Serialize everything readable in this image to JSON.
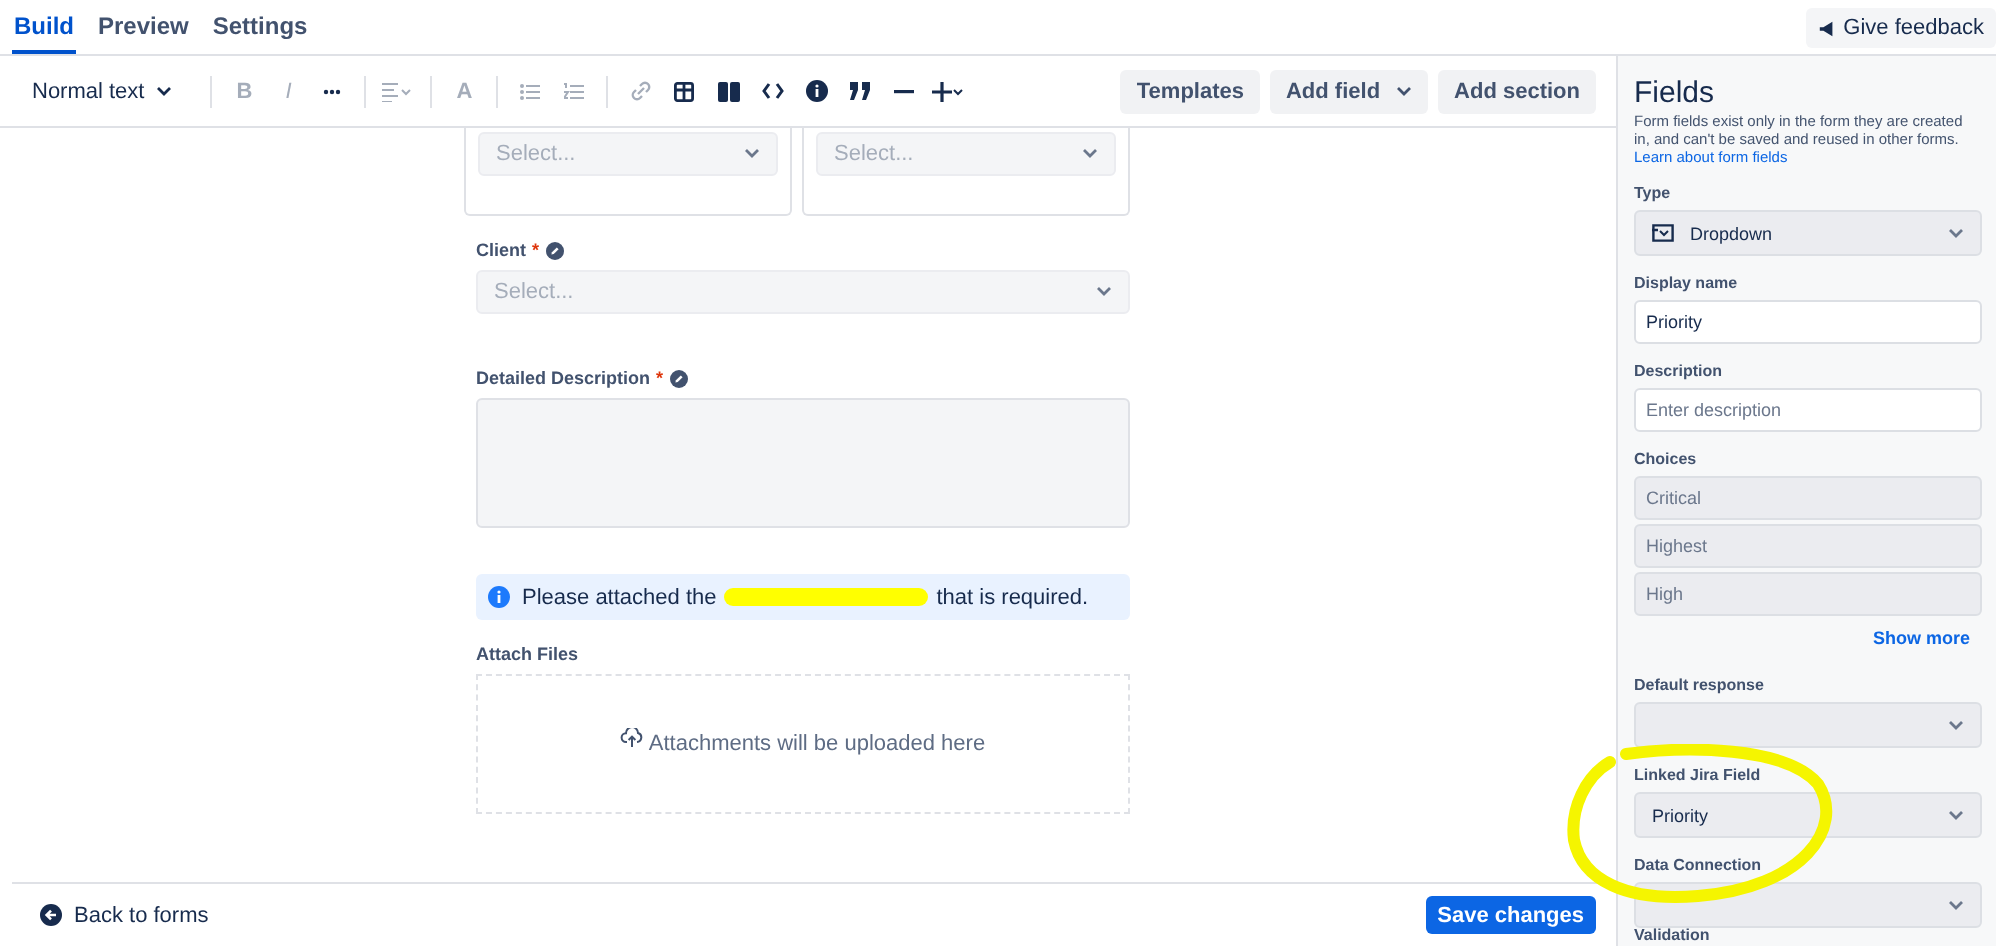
{
  "tabs": [
    {
      "label": "Build",
      "selected": true
    },
    {
      "label": "Preview",
      "selected": false
    },
    {
      "label": "Settings",
      "selected": false
    }
  ],
  "feedback_button": "Give feedback",
  "toolbar": {
    "text_style": "Normal text",
    "tools": [
      {
        "kind": "glyph",
        "glyph": "B",
        "disabled": true
      },
      {
        "kind": "glyph",
        "glyph": "I",
        "disabled": true
      },
      {
        "kind": "more",
        "disabled": false
      },
      {
        "kind": "align",
        "disabled": true
      },
      {
        "kind": "glyph",
        "glyph": "A",
        "disabled": true
      },
      {
        "kind": "bullets",
        "disabled": true
      },
      {
        "kind": "numbers",
        "disabled": true
      },
      {
        "kind": "link",
        "disabled": true
      },
      {
        "kind": "table",
        "disabled": false
      },
      {
        "kind": "columns",
        "disabled": false
      },
      {
        "kind": "code",
        "disabled": false
      },
      {
        "kind": "info",
        "disabled": false
      },
      {
        "kind": "quote",
        "disabled": false
      },
      {
        "kind": "rule",
        "disabled": false
      },
      {
        "kind": "insert",
        "disabled": false
      }
    ],
    "buttons": [
      {
        "label": "Templates",
        "dropdown": false
      },
      {
        "label": "Add field",
        "dropdown": true
      },
      {
        "label": "Add section",
        "dropdown": false
      }
    ]
  },
  "canvas": {
    "top_cards": [
      {
        "placeholder": "Select..."
      },
      {
        "placeholder": "Select..."
      }
    ],
    "fields": [
      {
        "kind": "select",
        "label": "Client",
        "required_mark": "*",
        "placeholder": "Select..."
      },
      {
        "kind": "textarea",
        "label": "Detailed Description",
        "required_mark": "*"
      },
      {
        "kind": "info",
        "text_before": "Please attached the",
        "text_after": "that is required."
      },
      {
        "kind": "attachments",
        "label": "Attach Files",
        "text": "Attachments will be uploaded here"
      }
    ]
  },
  "panel": {
    "title": "Fields",
    "description": "Form fields exist only in the form they are created in, and can't be saved and reused in other forms.",
    "link": "Learn about form fields",
    "sections": [
      {
        "kind": "select",
        "label": "Type",
        "value": "Dropdown",
        "icon": true
      },
      {
        "kind": "input",
        "label": "Display name",
        "value": "Priority"
      },
      {
        "kind": "input",
        "label": "Description",
        "placeholder": "Enter description"
      },
      {
        "kind": "choices",
        "label": "Choices",
        "choices": [
          "Critical",
          "Highest",
          "High"
        ],
        "more": "Show more"
      },
      {
        "kind": "select",
        "label": "Default response"
      },
      {
        "kind": "select",
        "label": "Linked Jira Field",
        "value": "Priority"
      },
      {
        "kind": "select",
        "label": "Data Connection"
      },
      {
        "kind": "heading",
        "label": "Validation"
      }
    ]
  },
  "footer": {
    "back": "Back to forms",
    "save": "Save changes"
  }
}
